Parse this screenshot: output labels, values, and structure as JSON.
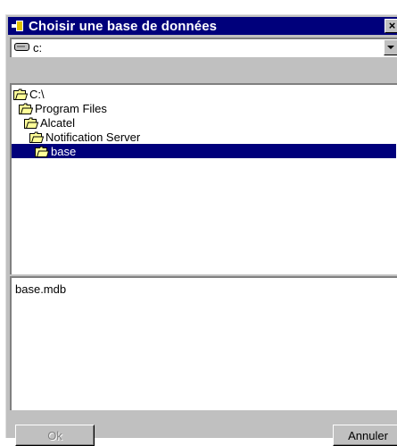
{
  "window": {
    "title": "Choisir une base de données",
    "close_label": "×"
  },
  "drive_selector": {
    "value": "c:",
    "icon": "drive-icon"
  },
  "folder_tree": {
    "items": [
      {
        "label": "C:\\",
        "icon": "open-folder-icon",
        "selected": false
      },
      {
        "label": "Program Files",
        "icon": "open-folder-icon",
        "selected": false
      },
      {
        "label": "Alcatel",
        "icon": "open-folder-icon",
        "selected": false
      },
      {
        "label": "Notification Server",
        "icon": "open-folder-icon",
        "selected": false
      },
      {
        "label": "base",
        "icon": "open-folder-icon",
        "selected": true
      }
    ]
  },
  "file_list": {
    "items": [
      "base.mdb"
    ]
  },
  "buttons": {
    "ok_label": "Ok",
    "cancel_label": "Annuler"
  },
  "colors": {
    "face": "#c0c0c0",
    "titlebar": "#00007b",
    "selection": "#00007b",
    "folder": "#ffff99"
  }
}
